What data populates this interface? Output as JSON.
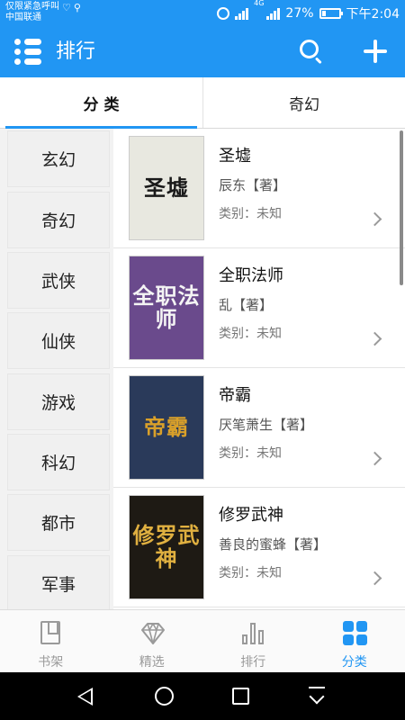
{
  "status_bar": {
    "carrier_line1": "仅限紧急呼叫",
    "carrier_line2": "中国联通",
    "net_type": "4G",
    "battery_text": "27%",
    "battery_level": 0.27,
    "time": "下午2:04"
  },
  "header": {
    "title": "排行"
  },
  "tabs": [
    {
      "label": "分 类",
      "active": true
    },
    {
      "label": "奇幻",
      "active": false
    }
  ],
  "categories": [
    {
      "label": "玄幻"
    },
    {
      "label": "奇幻"
    },
    {
      "label": "武侠"
    },
    {
      "label": "仙侠"
    },
    {
      "label": "游戏"
    },
    {
      "label": "科幻"
    },
    {
      "label": "都市"
    },
    {
      "label": "军事"
    }
  ],
  "books": [
    {
      "title": "圣墟",
      "author": "辰东【著】",
      "category": "类别：未知",
      "cover_text": "圣墟",
      "cover_bg": "#e8e8e0",
      "cover_fg": "#1a1a1a"
    },
    {
      "title": "全职法师",
      "author": "乱【著】",
      "category": "类别：未知",
      "cover_text": "全职法师",
      "cover_bg": "#6a4a8c",
      "cover_fg": "#f4f4f4"
    },
    {
      "title": "帝霸",
      "author": "厌笔萧生【著】",
      "category": "类别：未知",
      "cover_text": "帝霸",
      "cover_bg": "#2a3a5a",
      "cover_fg": "#d9a02a"
    },
    {
      "title": "修罗武神",
      "author": "善良的蜜蜂【著】",
      "category": "类别：未知",
      "cover_text": "修罗武神",
      "cover_bg": "#1e1a14",
      "cover_fg": "#e0b040"
    }
  ],
  "bottom_nav": [
    {
      "label": "书架",
      "icon": "bookmark-icon",
      "active": false
    },
    {
      "label": "精选",
      "icon": "diamond-icon",
      "active": false
    },
    {
      "label": "排行",
      "icon": "bar-chart-icon",
      "active": false
    },
    {
      "label": "分类",
      "icon": "grid-icon",
      "active": true
    }
  ],
  "colors": {
    "primary": "#2196f3",
    "inactive": "#9a9a9a"
  }
}
